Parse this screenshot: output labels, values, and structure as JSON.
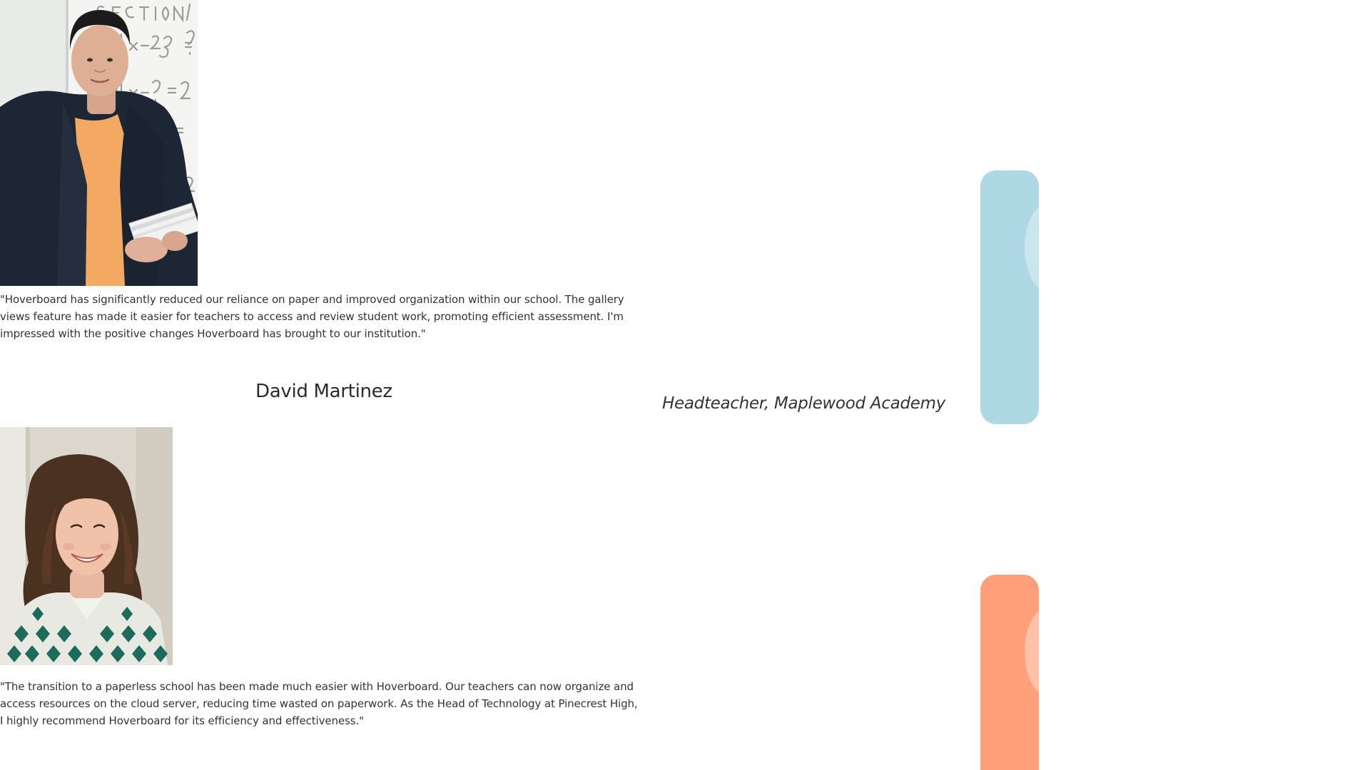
{
  "testimonials": [
    {
      "quote": "\"Hoverboard has significantly reduced our reliance on paper and improved organization within our school. The gallery views feature has made it easier for teachers to access and review student work, promoting efficient assessment. I'm impressed with the positive changes Hoverboard has brought to our institution.\"",
      "name": "David Martinez",
      "role": "Headteacher, Maplewood Academy",
      "accent": "#add8e4"
    },
    {
      "quote": "\"The transition to a paperless school has been made much easier with Hoverboard. Our teachers can now organize and access resources on the cloud server, reducing time wasted on paperwork. As the Head of Technology at Pinecrest High, I highly recommend Hoverboard for its efficiency and effectiveness.\"",
      "accent": "#ffa07a"
    }
  ],
  "colors": {
    "blue_pill": "#add8e4",
    "orange_pill": "#ffa07a",
    "text": "#333333"
  }
}
